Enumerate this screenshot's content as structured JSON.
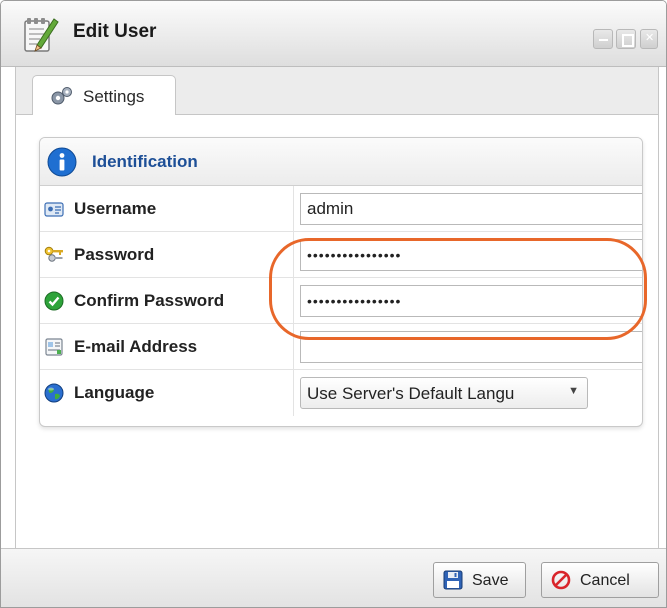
{
  "window": {
    "title": "Edit User"
  },
  "tabs": [
    {
      "label": "Settings",
      "icon": "gears-icon",
      "active": true
    }
  ],
  "panel": {
    "title": "Identification",
    "icon": "info-icon"
  },
  "form": {
    "username": {
      "label": "Username",
      "value": "admin",
      "icon": "id-card-icon"
    },
    "password": {
      "label": "Password",
      "value": "••••••••••••••••",
      "icon": "keys-icon"
    },
    "confirm_password": {
      "label": "Confirm Password",
      "value": "••••••••••••••••",
      "icon": "checkmark-icon"
    },
    "email": {
      "label": "E-mail Address",
      "value": "",
      "icon": "address-card-icon"
    },
    "language": {
      "label": "Language",
      "value": "Use Server's Default Langu",
      "icon": "globe-icon"
    }
  },
  "footer": {
    "save_label": "Save",
    "cancel_label": "Cancel"
  },
  "colors": {
    "accent_title": "#1d4f97",
    "highlight": "#e8672a",
    "cancel_red": "#d9252b"
  }
}
